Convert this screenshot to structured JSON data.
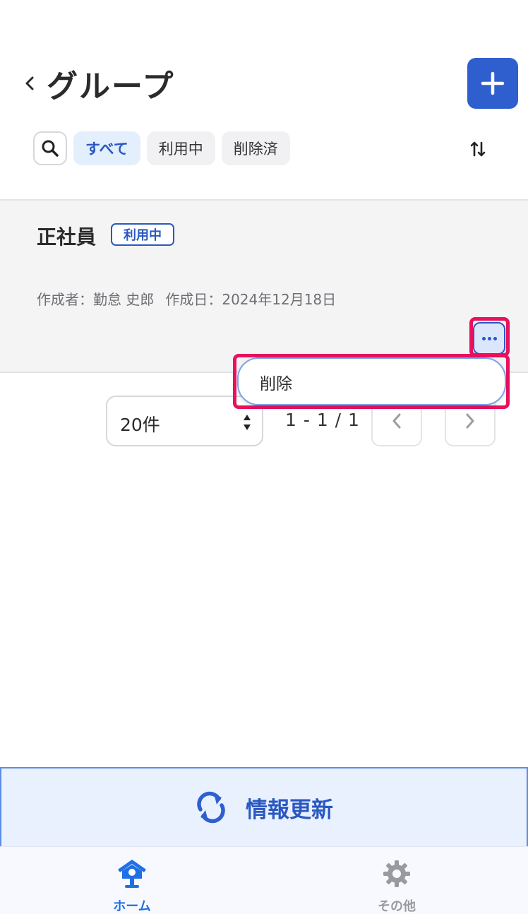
{
  "header": {
    "title": "グループ",
    "back_icon": "chevron-left-icon",
    "add_icon": "plus-icon"
  },
  "filters": {
    "search_icon": "search-icon",
    "chips": [
      {
        "label": "すべて",
        "active": true
      },
      {
        "label": "利用中",
        "active": false
      },
      {
        "label": "削除済",
        "active": false
      }
    ],
    "sort_icon": "sort-icon"
  },
  "groups": [
    {
      "name": "正社員",
      "status": "利用中",
      "creator": "作成者：勤怠 史郎",
      "created_date": "作成日：2024年12月18日"
    }
  ],
  "menu": {
    "items": [
      {
        "label": "削除"
      }
    ]
  },
  "pager": {
    "page_size": "20件",
    "range": "1 - 1 / 1"
  },
  "refresh": {
    "label": "情報更新",
    "icon": "refresh-icon"
  },
  "tabbar": {
    "items": [
      {
        "label": "ホーム",
        "icon": "home-icon",
        "active": true
      },
      {
        "label": "その他",
        "icon": "gear-icon",
        "active": false
      }
    ]
  },
  "colors": {
    "accent": "#2f5fcf",
    "highlight": "#e8115e",
    "tab_active": "#1f6fe5"
  }
}
